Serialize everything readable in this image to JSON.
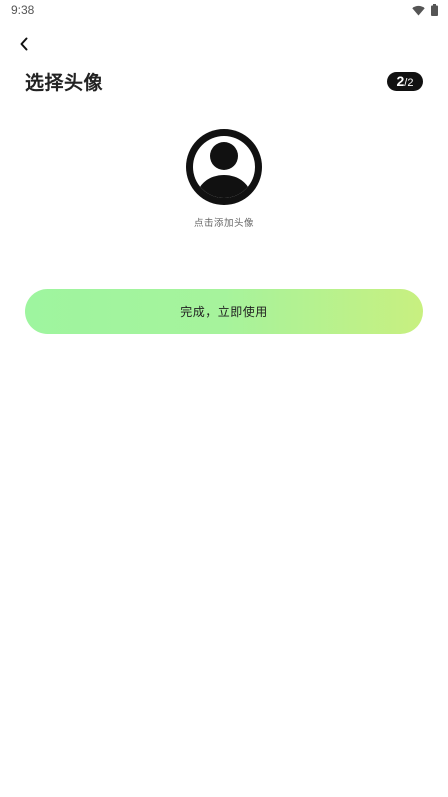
{
  "status_bar": {
    "time": "9:38",
    "icons": [
      "wifi-icon",
      "battery-icon"
    ]
  },
  "header": {
    "back_icon": "chevron-left-icon",
    "title": "选择头像",
    "step_current": "2",
    "step_total": "/2"
  },
  "avatar": {
    "icon": "user-avatar-icon",
    "hint": "点击添加头像"
  },
  "actions": {
    "complete_label": "完成，立即使用"
  },
  "colors": {
    "button_gradient_start": "#9ef59f",
    "button_gradient_end": "#c8f080",
    "badge_bg": "#111111",
    "avatar_fill": "#111111"
  }
}
